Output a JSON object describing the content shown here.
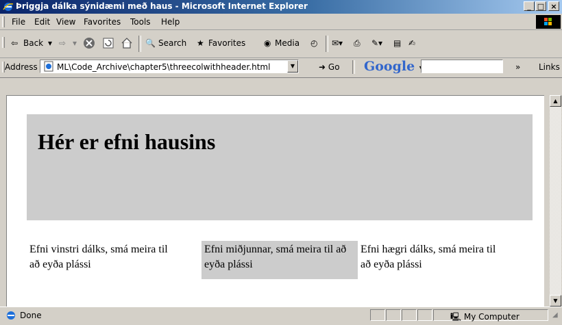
{
  "window": {
    "title": "Þriggja dálka sýnidæmi með haus - Microsoft Internet Explorer",
    "minimize": "_",
    "maximize": "□",
    "close": "×"
  },
  "menu": [
    "File",
    "Edit",
    "View",
    "Favorites",
    "Tools",
    "Help"
  ],
  "toolbar": {
    "back": "Back",
    "search": "Search",
    "favorites": "Favorites",
    "media": "Media"
  },
  "address": {
    "label": "Address",
    "value": "ML\\Code_Archive\\chapter5\\threecolwithheader.html",
    "go": "Go",
    "google": "Google",
    "google_dropdown": "▾",
    "links": "Links"
  },
  "page": {
    "header": "Hér er efni hausins",
    "left": "Efni vinstri dálks, smá meira til að eyða plássi",
    "middle": "Efni miðjunnar, smá meira til að eyða plássi",
    "right": "Efni hægri dálks, smá meira til að eyða plássi"
  },
  "status": {
    "text": "Done",
    "zone": "My Computer"
  },
  "colors": {
    "titlebar": "#0a246a",
    "header_bg": "#cccccc",
    "chrome": "#d4d0c8"
  }
}
